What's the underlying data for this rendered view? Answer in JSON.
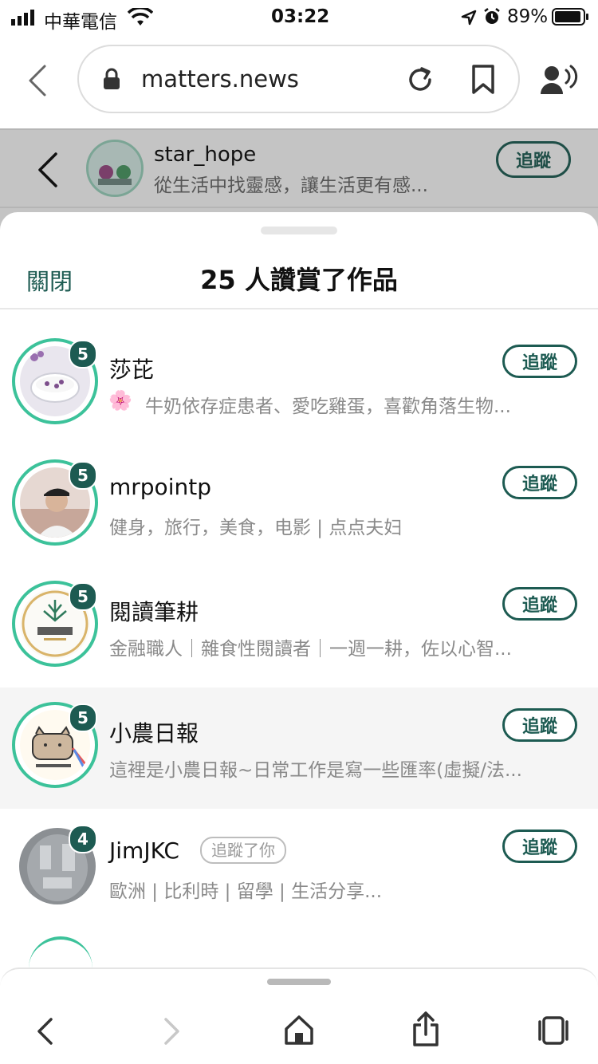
{
  "status_bar": {
    "carrier": "中華電信",
    "time": "03:22",
    "battery": "89%"
  },
  "browser": {
    "url": "matters.news"
  },
  "header": {
    "username": "star_hope",
    "tagline": "從生活中找靈感，讓生活更有感...",
    "follow_label": "追蹤"
  },
  "sheet": {
    "close_label": "關閉",
    "title": "25 人讚賞了作品",
    "users": [
      {
        "name": "莎芘",
        "bio_emoji": "🌸",
        "bio": "牛奶依存症患者、愛吃雞蛋，喜歡角落生物...",
        "count": "5",
        "follow_label": "追蹤"
      },
      {
        "name": "mrpointp",
        "bio": "健身，旅行，美食，电影 | 点点夫妇",
        "count": "5",
        "follow_label": "追蹤"
      },
      {
        "name": "閱讀筆耕",
        "bio": "金融職人｜雜食性閱讀者｜一週一耕，佐以心智...",
        "count": "5",
        "follow_label": "追蹤"
      },
      {
        "name": "小農日報",
        "bio": "這裡是小農日報~日常工作是寫一些匯率(虛擬/法...",
        "count": "5",
        "follow_label": "追蹤"
      },
      {
        "name": "JimJKC",
        "followed_you": "追蹤了你",
        "bio": "歐洲 | 比利時 | 留學 | 生活分享...",
        "count": "4",
        "follow_label": "追蹤"
      }
    ]
  },
  "colors": {
    "accent": "#1d5b52",
    "ring": "#3cc29a",
    "dim": "#c4c4c4"
  },
  "icons": [
    "back-chevron-icon",
    "lock-icon",
    "reload-icon",
    "bookmark-icon",
    "reader-voice-icon",
    "back-icon",
    "forward-icon",
    "home-icon",
    "share-icon",
    "tabs-icon"
  ]
}
